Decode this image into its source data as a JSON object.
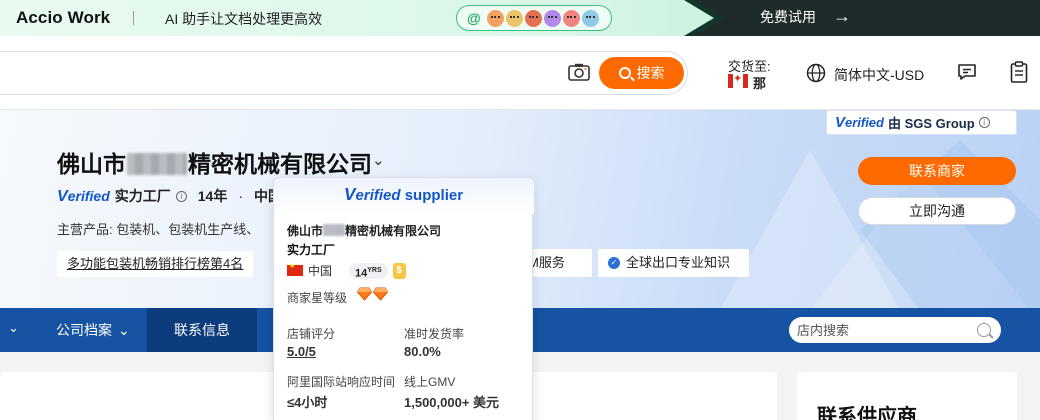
{
  "banner": {
    "brand": "Accio Work",
    "slogan": "AI 助手让文档处理更高效",
    "at_symbol": "@",
    "trial": "免费试用",
    "avatar_colors": [
      "#f4a261",
      "#e9c46a",
      "#e76f51",
      "#b388eb",
      "#f28482",
      "#8ecae6"
    ]
  },
  "header": {
    "search_button": "搜索",
    "ship_to_label": "交货至:",
    "ship_to_country": "那",
    "language": "简体中文-USD"
  },
  "hero": {
    "sgs": {
      "verified_v": "V",
      "verified_rest": "erified",
      "by": "由 SGS Group"
    },
    "company_prefix": "佛山市",
    "company_suffix": "精密机械有限公司",
    "verified_v": "V",
    "verified_rest": "erified",
    "factory": "实力工厂",
    "years": "14年",
    "dot": "·",
    "location_partial": "中国",
    "main_products": "主营产品: 包装机、包装机生产线、",
    "rank_tag": "多功能包装机畅销排行榜第4名",
    "oem_tag": "M服务",
    "export_tag": "全球出口专业知识",
    "contact_button": "联系商家",
    "chat_button": "立即沟通"
  },
  "nav": {
    "tabs": [
      {
        "label": "公司档案",
        "chevron": "⌄"
      },
      {
        "label": "联系信息"
      }
    ],
    "store_search_placeholder": "店内搜索"
  },
  "content": {
    "right_title": "联系供应商"
  },
  "tooltip": {
    "verified_v": "V",
    "verified_rest": "erified",
    "verified_supplier": "supplier",
    "company_prefix": "佛山市",
    "company_suffix": "精密机械有限公司",
    "factory": "实力工厂",
    "country": "中国",
    "years_num": "14",
    "years_unit": "YRS",
    "gold_mark": "$",
    "star_label": "商家星等级",
    "metrics": [
      {
        "label": "店铺评分",
        "value": "5.0/5"
      },
      {
        "label": "准时发货率",
        "value": "80.0%"
      },
      {
        "label": "阿里国际站响应时间",
        "value": "≤4小时"
      },
      {
        "label": "线上GMV",
        "value": "1,500,000+ 美元"
      }
    ]
  },
  "colors": {
    "accent_orange": "#ff6a00",
    "nav_blue": "#1653a3",
    "verified_blue": "#1357c7"
  }
}
